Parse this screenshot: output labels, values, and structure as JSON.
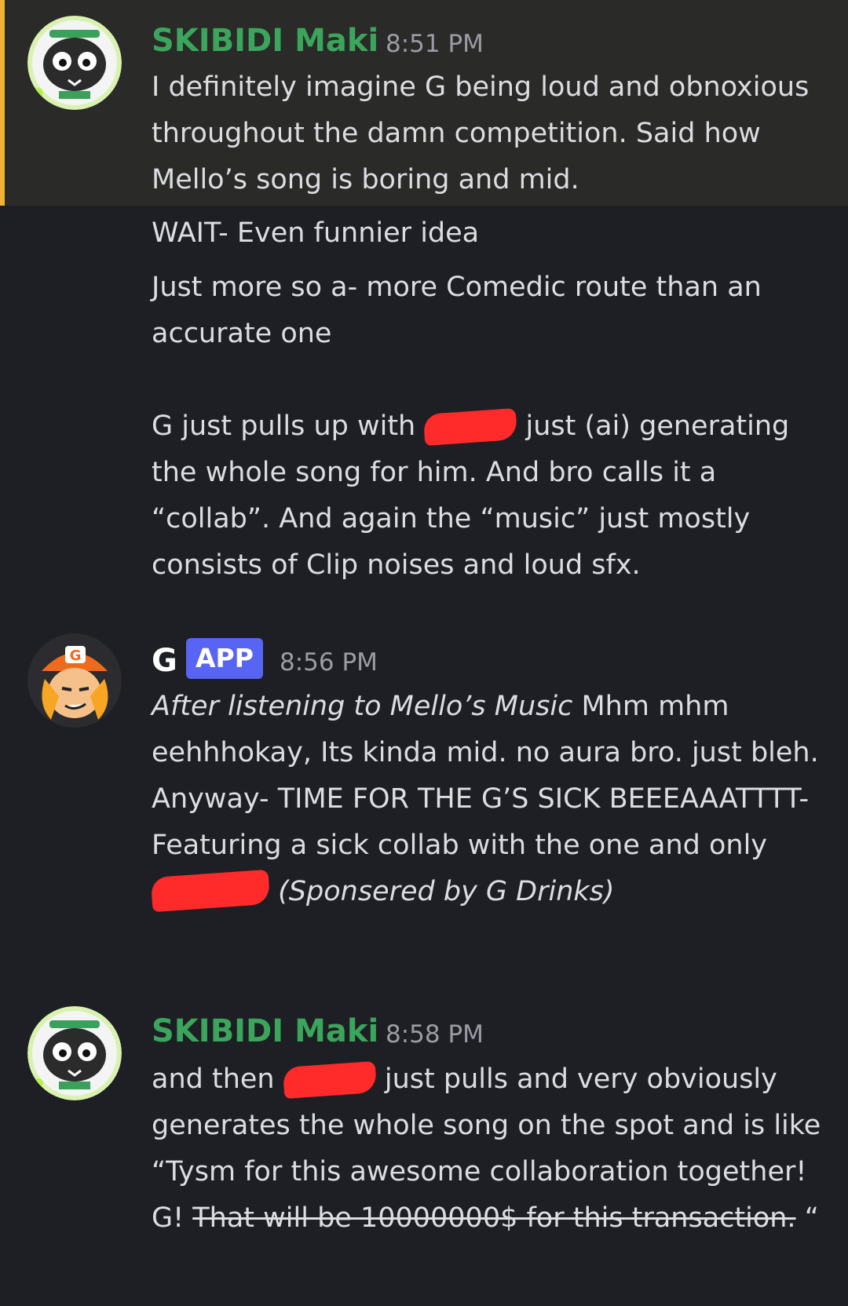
{
  "messages": [
    {
      "author": "SKIBIDI Maki",
      "author_color": "#3ba55c",
      "time": "8:51 PM",
      "highlighted": true,
      "lines": [
        "I definitely imagine G being loud and obnoxious throughout the damn competition. Said how Mello’s song is boring and mid."
      ]
    },
    {
      "lines": [
        "WAIT- Even funnier idea",
        "Just more so a- more Comedic route than an accurate one",
        "G just pulls up with",
        "just (ai) generating the whole song for him. And bro calls it a “collab”. And again the “music” just mostly consists of Clip noises and loud sfx."
      ]
    },
    {
      "author": "G",
      "author_color": "#ffffff",
      "badge": "APP",
      "time": "8:56 PM",
      "italic_intro": "After listening to Mello’s Music",
      "text": " Mhm mhm eehhhokay, Its kinda mid. no aura bro. just bleh. Anyway- TIME FOR THE G’S SICK BEEEAAATTTT- Featuring a sick collab with the one and only",
      "italic_outro": "(Sponsered by G Drinks)"
    },
    {
      "author": "SKIBIDI Maki",
      "author_color": "#3ba55c",
      "time": "8:58 PM",
      "text_before": "and then",
      "text_after": "just pulls and very obviously generates the whole song on the spot and is like “Tysm for this awesome collaboration together! G! ",
      "strikethrough": "That will be 10000000$ for this transaction.",
      "closing_quote": " “"
    }
  ],
  "icons": {
    "maki_avatar": "dark-creature-avatar-icon",
    "g_avatar": "orange-cap-character-avatar-icon"
  },
  "colors": {
    "background": "#1e1f24",
    "highlight_bg": "#2a2a28",
    "highlight_bar": "#f0b232",
    "app_badge": "#5865f2",
    "redaction": "#ff2a2a"
  }
}
